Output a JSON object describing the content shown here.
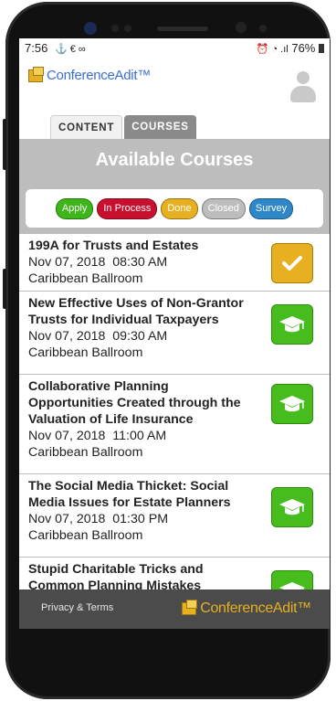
{
  "status": {
    "time": "7:56",
    "left_icons": "⚓ € ∞",
    "right_icons": "⏰ ◔ .ıl",
    "battery": "76%"
  },
  "header": {
    "logo_text": "ConferenceAdit™",
    "tabs": [
      "CONTENT",
      "COURSES"
    ]
  },
  "banner": {
    "title": "Available Courses",
    "legend": [
      {
        "label": "Apply",
        "color": "#3db61a"
      },
      {
        "label": "In Process",
        "color": "#c8102e"
      },
      {
        "label": "Done",
        "color": "#e7b020"
      },
      {
        "label": "Closed",
        "color": "#bdbdbd"
      },
      {
        "label": "Survey",
        "color": "#2d87c8"
      }
    ]
  },
  "courses": [
    {
      "title": "199A for Trusts and Estates",
      "datetime": "Nov 07, 2018  08:30 AM",
      "location": "Caribbean Ballroom",
      "status": "done",
      "icon": "checkmark-icon"
    },
    {
      "title": "New Effective Uses of Non-Grantor Trusts for Individual Taxpayers",
      "datetime": "Nov 07, 2018  09:30 AM",
      "location": "Caribbean Ballroom",
      "status": "apply",
      "icon": "graduation-cap-icon"
    },
    {
      "title": "Collaborative Planning Opportunities Created through the Valuation of Life Insurance",
      "datetime": "Nov 07, 2018  11:00 AM",
      "location": "Caribbean Ballroom",
      "status": "apply",
      "icon": "graduation-cap-icon"
    },
    {
      "title": "The Social Media Thicket: Social Media Issues for Estate Planners",
      "datetime": "Nov 07, 2018  01:30 PM",
      "location": "Caribbean Ballroom",
      "status": "apply",
      "icon": "graduation-cap-icon"
    },
    {
      "title": "Stupid Charitable Tricks and Common Planning Mistakes",
      "datetime": "",
      "location": "",
      "status": "apply",
      "icon": "graduation-cap-icon"
    }
  ],
  "footer": {
    "privacy": "Privacy & Terms",
    "logo_text": "ConferenceAdit™"
  },
  "navbar": {
    "recent": "|||",
    "home": "○",
    "back": "<"
  }
}
